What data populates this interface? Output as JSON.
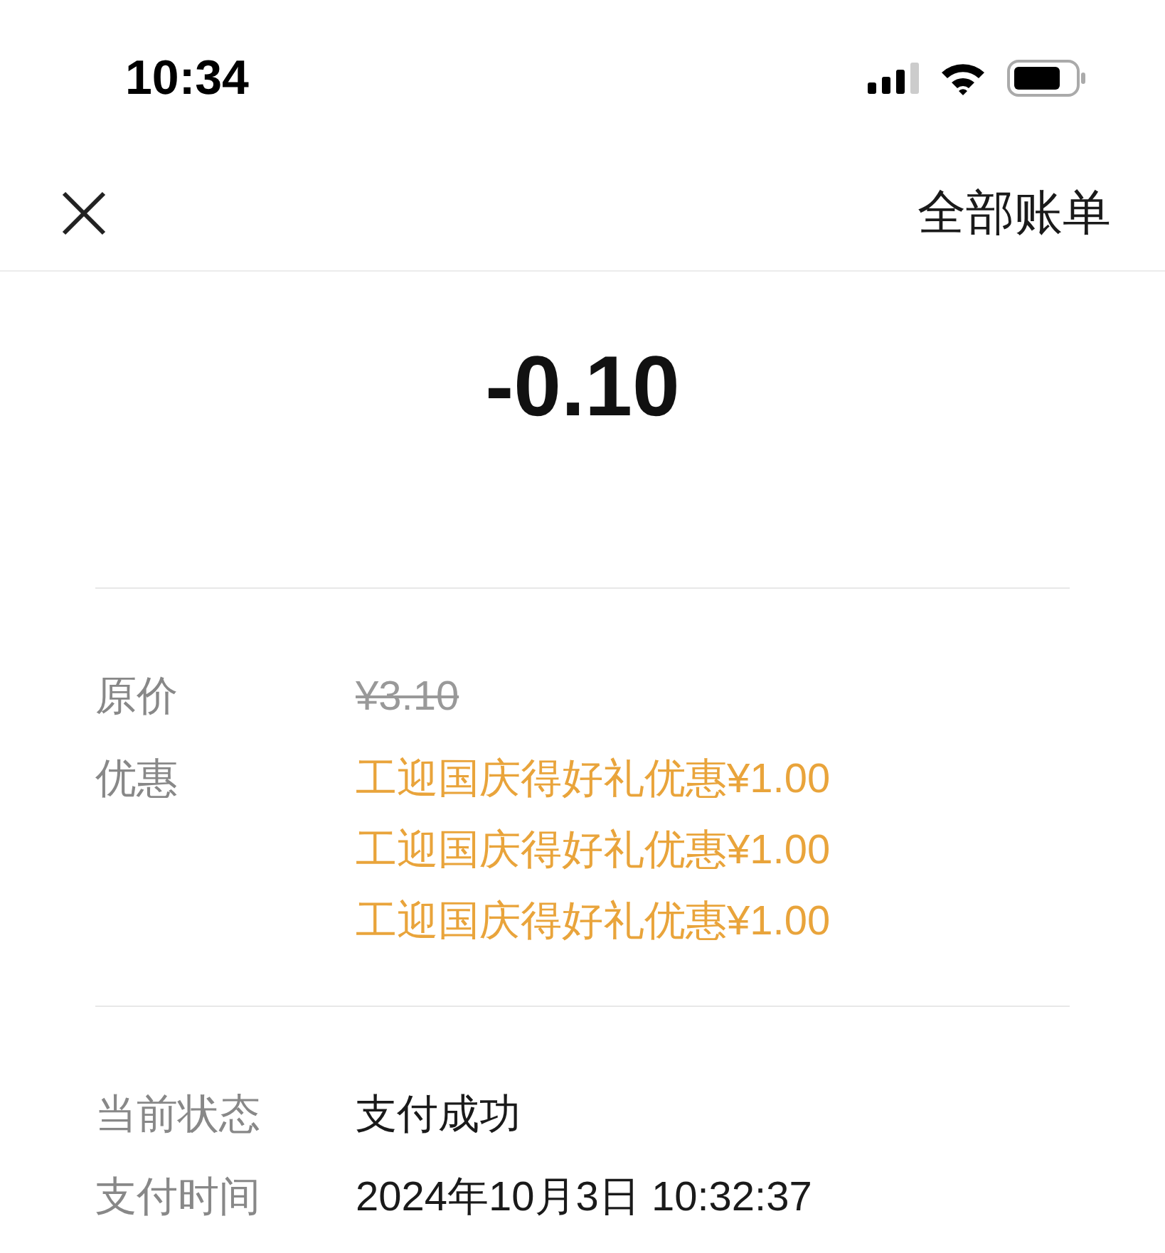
{
  "status_bar": {
    "time": "10:34"
  },
  "nav": {
    "action": "全部账单"
  },
  "amount": "-0.10",
  "sections": [
    {
      "rows": [
        {
          "label": "原价",
          "kind": "struck",
          "values": [
            "¥3.10"
          ]
        },
        {
          "label": "优惠",
          "kind": "discount",
          "values": [
            "工迎国庆得好礼优惠¥1.00",
            "工迎国庆得好礼优惠¥1.00",
            "工迎国庆得好礼优惠¥1.00"
          ]
        }
      ]
    },
    {
      "rows": [
        {
          "label": "当前状态",
          "kind": "plain",
          "values": [
            "支付成功"
          ]
        },
        {
          "label": "支付时间",
          "kind": "plain",
          "values": [
            "2024年10月3日 10:32:37"
          ]
        }
      ]
    }
  ]
}
